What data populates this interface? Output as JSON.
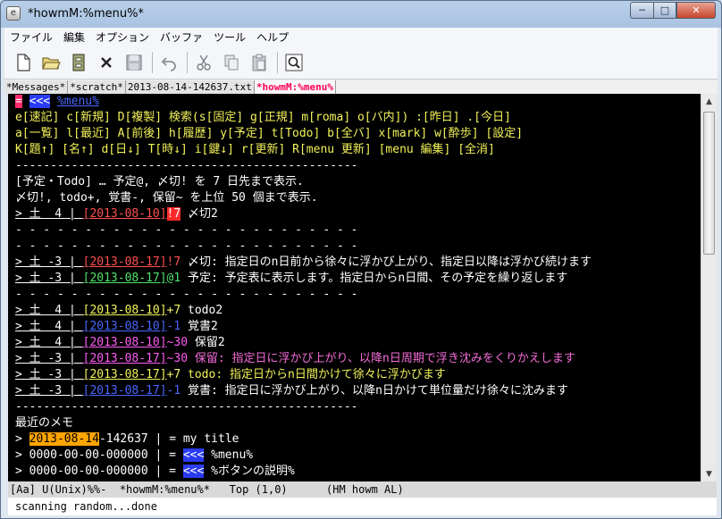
{
  "window": {
    "title": "*howmM:%menu%*",
    "app_icon": "emacs-icon"
  },
  "menu": [
    "ファイル",
    "編集",
    "オプション",
    "バッファ",
    "ツール",
    "ヘルプ"
  ],
  "tabs": [
    {
      "label": "*Messages*"
    },
    {
      "label": "*scratch*"
    },
    {
      "label": "2013-08-14-142637.txt"
    },
    {
      "label": "*howmM:%menu%"
    }
  ],
  "editor": {
    "header": {
      "marker": "=",
      "back_button": "<<<",
      "title": "%menu%"
    },
    "shortcut_rows": [
      "e[速記] c[新規] D[複製] 検索(s[固定] g[正規] m[roma] o[バ内]) :[昨日] .[今日]",
      "a[一覧] l[最近] A[前後] h[履歴] y[予定] t[Todo] b[全バ] x[mark] w[酔歩] [設定]",
      "K[題↑] [名↑] d[日↓] T[時↓] i[鍵↓] r[更新] R[menu 更新] [menu 編集] [全消]"
    ],
    "separator": "-------------------------------------------------",
    "dashed_separator": "- - - - - - - - - - - - - - - - - - - - - - - - -",
    "info_lines": [
      "[予定・Todo] … 予定@, 〆切! を 7 日先まで表示.",
      "〆切!, todo+, 覚書-, 保留~ を上位 50 個まで表示."
    ],
    "entry_top": {
      "prefix": "> 土  4 | ",
      "date": "[2013-08-10]",
      "mark": "!7",
      "text": " 〆切2"
    },
    "entries_group1": [
      {
        "prefix": "> 土 -3 | ",
        "date": "[2013-08-17]",
        "mark": "!7",
        "text": " 〆切: 指定日のn日前から徐々に浮かび上がり、指定日以降は浮かび続けます",
        "color": "red"
      },
      {
        "prefix": "> 土 -3 | ",
        "date": "[2013-08-17]",
        "mark": "@1",
        "text": " 予定: 予定表に表示します。指定日からn日間、その予定を繰り返します",
        "color": "green"
      }
    ],
    "entries_group2": [
      {
        "prefix": "> 土  4 | ",
        "date": "[2013-08-10]",
        "mark": "+7",
        "text": " todo2",
        "color": "yellow"
      },
      {
        "prefix": "> 土  4 | ",
        "date": "[2013-08-10]",
        "mark": "-1",
        "text": " 覚書2",
        "color": "blue"
      },
      {
        "prefix": "> 土  4 | ",
        "date": "[2013-08-10]",
        "mark": "~30",
        "text": " 保留2",
        "color": "magenta"
      },
      {
        "prefix": "> 土 -3 | ",
        "date": "[2013-08-17]",
        "mark": "~30",
        "text": " 保留: 指定日に浮かび上がり、以降n日周期で浮き沈みをくりかえします",
        "color": "magenta"
      },
      {
        "prefix": "> 土 -3 | ",
        "date": "[2013-08-17]",
        "mark": "+7",
        "text": " todo: 指定日からn日間かけて徐々に浮かびます",
        "color": "yellow"
      },
      {
        "prefix": "> 土 -3 | ",
        "date": "[2013-08-17]",
        "mark": "-1",
        "text": " 覚書: 指定日に浮かび上がり、以降n日かけて単位量だけ徐々に沈みます",
        "color": "blue"
      }
    ],
    "recent_heading": "最近のメモ",
    "recent": [
      {
        "prefix": "> ",
        "date_hl": "2013-08-14",
        "rest": "-142637 | = my title"
      },
      {
        "prefix": "> 0000-00-00-000000 | = ",
        "button": "<<<",
        "text": " %menu%"
      },
      {
        "prefix": "> 0000-00-00-000000 | = ",
        "button": "<<<",
        "text": " %ボタンの説明%"
      }
    ]
  },
  "modeline": "[Aa] U(Unix)%%-  *howmM:%menu%*   Top (1,0)      (HM howm AL)",
  "minibuffer": "scanning random...done",
  "colors": {
    "magenta": "#ff5cf6",
    "yellow": "#f2f25a",
    "red": "#ff4f4f",
    "green": "#4fe36a",
    "blue": "#4a66ff",
    "button_bg": "#2a3bf2",
    "highlight": "#ffa500"
  }
}
